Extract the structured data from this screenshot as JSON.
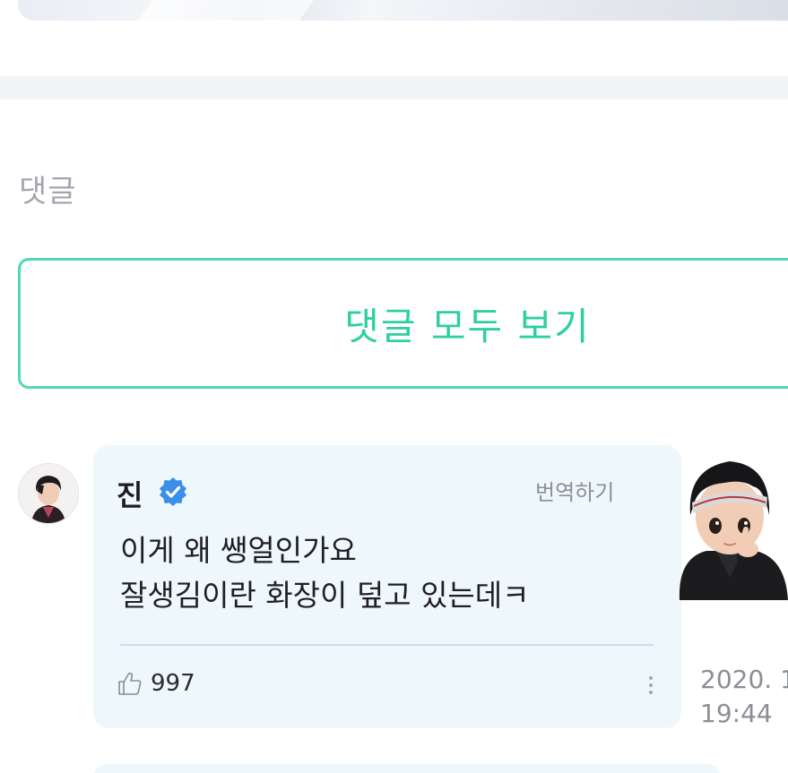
{
  "section": {
    "title": "댓글"
  },
  "view_all": {
    "label": "댓글 모두 보기"
  },
  "comment": {
    "author": "진",
    "translate_label": "번역하기",
    "lines": [
      "이게 왜 쌩얼인가요",
      "잘생김이란 화장이 덮고 있는데ㅋ"
    ],
    "likes": "997",
    "date": "2020. 1",
    "time": "19:44"
  },
  "colors": {
    "accent": "#2fcfa3",
    "accent_border": "#4fd9b6",
    "bubble_bg": "#eef7fc",
    "verified": "#3b8eea",
    "muted_text": "#8d9096"
  },
  "icons": {
    "verified": "verified-badge-icon",
    "like": "thumbs-up-icon",
    "more": "more-vertical-icon"
  }
}
